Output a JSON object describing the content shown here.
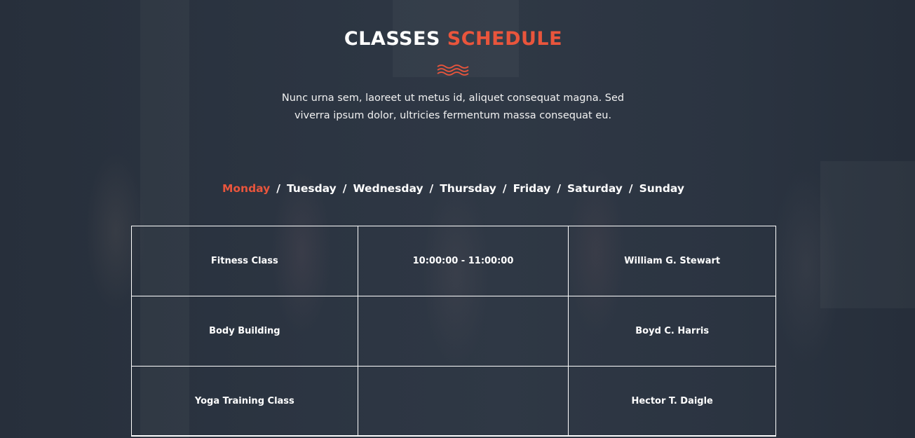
{
  "section": {
    "title_main": "CLASSES",
    "title_accent": "SCHEDULE",
    "intro": "Nunc urna sem, laoreet ut metus id, aliquet consequat magna. Sed viverra ipsum dolor, ultricies fermentum massa consequat eu."
  },
  "colors": {
    "accent": "#e9553c",
    "overlay": "#27303c",
    "text": "#ffffff"
  },
  "icons": {
    "divider": "wave-divider-icon"
  },
  "days": [
    {
      "label": "Monday",
      "active": true
    },
    {
      "label": "Tuesday",
      "active": false
    },
    {
      "label": "Wednesday",
      "active": false
    },
    {
      "label": "Thursday",
      "active": false
    },
    {
      "label": "Friday",
      "active": false
    },
    {
      "label": "Saturday",
      "active": false
    },
    {
      "label": "Sunday",
      "active": false
    }
  ],
  "day_separator": "/",
  "schedule": {
    "rows": [
      {
        "class_name": "Fitness Class",
        "time": "10:00:00 - 11:00:00",
        "trainer": "William G. Stewart"
      },
      {
        "class_name": "Body Building",
        "time": "",
        "trainer": "Boyd C. Harris"
      },
      {
        "class_name": "Yoga Training Class",
        "time": "",
        "trainer": "Hector T. Daigle"
      }
    ]
  }
}
